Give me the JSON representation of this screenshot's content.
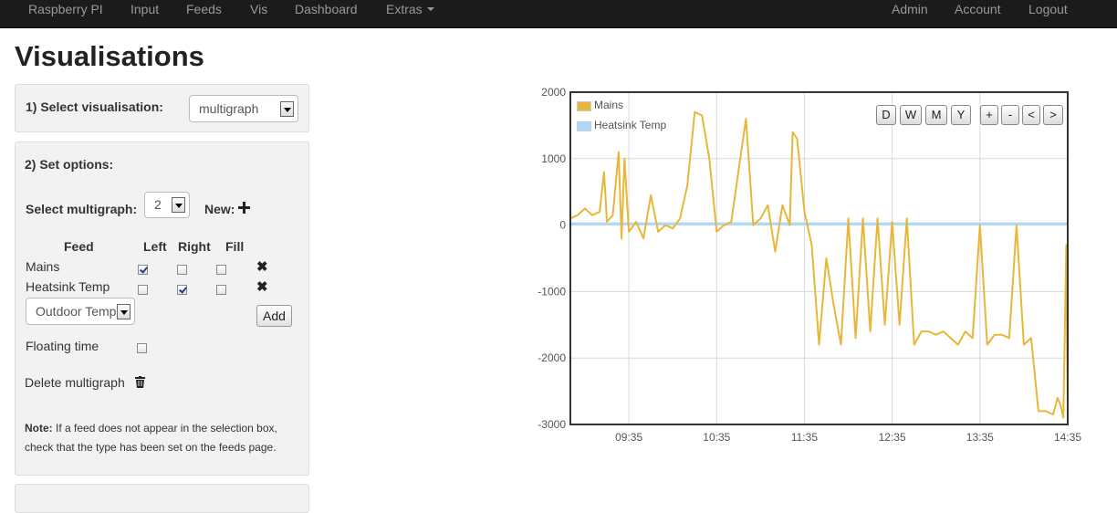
{
  "navbar": {
    "brand": "Raspberry PI",
    "items": [
      "Input",
      "Feeds",
      "Vis",
      "Dashboard",
      "Extras"
    ],
    "right_items": [
      "Admin",
      "Account",
      "Logout"
    ]
  },
  "page_title": "Visualisations",
  "step1": {
    "label": "1) Select visualisation:",
    "selected": "multigraph"
  },
  "step2": {
    "label": "2) Set options:",
    "multigraph_label": "Select multigraph:",
    "multigraph_selected": "2",
    "new_label": "New:",
    "new_icon": "plus-icon",
    "table_headers": [
      "Feed",
      "Left",
      "Right",
      "Fill"
    ],
    "feeds": [
      {
        "name": "Mains",
        "left": true,
        "right": false,
        "fill": false
      },
      {
        "name": "Heatsink Temp",
        "left": false,
        "right": true,
        "fill": false
      }
    ],
    "remove_icon": "close-icon",
    "feed_select": "Outdoor Temp",
    "add_label": "Add",
    "floating_time_label": "Floating time",
    "floating_time": false,
    "delete_label": "Delete multigraph",
    "delete_icon": "trash-icon",
    "note_bold": "Note:",
    "note_text": " If a feed does not appear in the selection box, check that the type has been set on the feeds page."
  },
  "chart_controls": [
    "D",
    "W",
    "M",
    "Y",
    "+",
    "-",
    "<",
    ">"
  ],
  "colors": {
    "mains": "#e8b73a",
    "heatsink": "#afd8f8",
    "nav_bg": "#1b1b1b"
  },
  "chart_data": {
    "type": "line",
    "ylim": [
      -3000,
      2000
    ],
    "y_ticks": [
      "2000",
      "1000",
      "0",
      "-1000",
      "-2000",
      "-3000"
    ],
    "x_ticks": [
      "09:35",
      "10:35",
      "11:35",
      "12:35",
      "13:35",
      "14:35"
    ],
    "legend_position": "top-left",
    "grid": true,
    "series": [
      {
        "name": "Mains",
        "color": "#e8b73a",
        "points": [
          [
            "08:55",
            100
          ],
          [
            "09:00",
            150
          ],
          [
            "09:05",
            250
          ],
          [
            "09:10",
            150
          ],
          [
            "09:15",
            200
          ],
          [
            "09:18",
            800
          ],
          [
            "09:20",
            50
          ],
          [
            "09:24",
            150
          ],
          [
            "09:28",
            1100
          ],
          [
            "09:30",
            -200
          ],
          [
            "09:32",
            1000
          ],
          [
            "09:35",
            -100
          ],
          [
            "09:40",
            50
          ],
          [
            "09:45",
            -200
          ],
          [
            "09:50",
            450
          ],
          [
            "09:55",
            -100
          ],
          [
            "10:00",
            0
          ],
          [
            "10:05",
            -50
          ],
          [
            "10:10",
            100
          ],
          [
            "10:15",
            600
          ],
          [
            "10:20",
            1700
          ],
          [
            "10:25",
            1650
          ],
          [
            "10:30",
            1000
          ],
          [
            "10:35",
            -100
          ],
          [
            "10:40",
            0
          ],
          [
            "10:45",
            50
          ],
          [
            "10:55",
            1600
          ],
          [
            "11:00",
            0
          ],
          [
            "11:05",
            100
          ],
          [
            "11:10",
            300
          ],
          [
            "11:15",
            -400
          ],
          [
            "11:20",
            300
          ],
          [
            "11:25",
            0
          ],
          [
            "11:27",
            1400
          ],
          [
            "11:30",
            1300
          ],
          [
            "11:35",
            200
          ],
          [
            "11:40",
            -300
          ],
          [
            "11:45",
            -1800
          ],
          [
            "11:50",
            -500
          ],
          [
            "11:55",
            -1200
          ],
          [
            "12:00",
            -1800
          ],
          [
            "12:05",
            100
          ],
          [
            "12:10",
            -1700
          ],
          [
            "12:15",
            100
          ],
          [
            "12:20",
            -1600
          ],
          [
            "12:25",
            100
          ],
          [
            "12:30",
            -1500
          ],
          [
            "12:35",
            50
          ],
          [
            "12:40",
            -1500
          ],
          [
            "12:45",
            100
          ],
          [
            "12:50",
            -1800
          ],
          [
            "12:55",
            -1600
          ],
          [
            "13:00",
            -1600
          ],
          [
            "13:05",
            -1650
          ],
          [
            "13:10",
            -1600
          ],
          [
            "13:15",
            -1700
          ],
          [
            "13:20",
            -1800
          ],
          [
            "13:25",
            -1600
          ],
          [
            "13:30",
            -1700
          ],
          [
            "13:35",
            0
          ],
          [
            "13:40",
            -1800
          ],
          [
            "13:45",
            -1650
          ],
          [
            "13:50",
            -1650
          ],
          [
            "13:55",
            -1700
          ],
          [
            "14:00",
            0
          ],
          [
            "14:05",
            -1800
          ],
          [
            "14:10",
            -1700
          ],
          [
            "14:15",
            -2800
          ],
          [
            "14:20",
            -2800
          ],
          [
            "14:25",
            -2850
          ],
          [
            "14:28",
            -2600
          ],
          [
            "14:30",
            -2700
          ],
          [
            "14:32",
            -2900
          ],
          [
            "14:34",
            -300
          ],
          [
            "14:35",
            -2900
          ]
        ]
      },
      {
        "name": "Heatsink Temp",
        "color": "#afd8f8",
        "points": [
          [
            "08:55",
            20
          ],
          [
            "10:00",
            20
          ],
          [
            "11:00",
            20
          ],
          [
            "12:00",
            20
          ],
          [
            "13:00",
            20
          ],
          [
            "14:00",
            20
          ],
          [
            "14:35",
            20
          ]
        ]
      }
    ]
  }
}
